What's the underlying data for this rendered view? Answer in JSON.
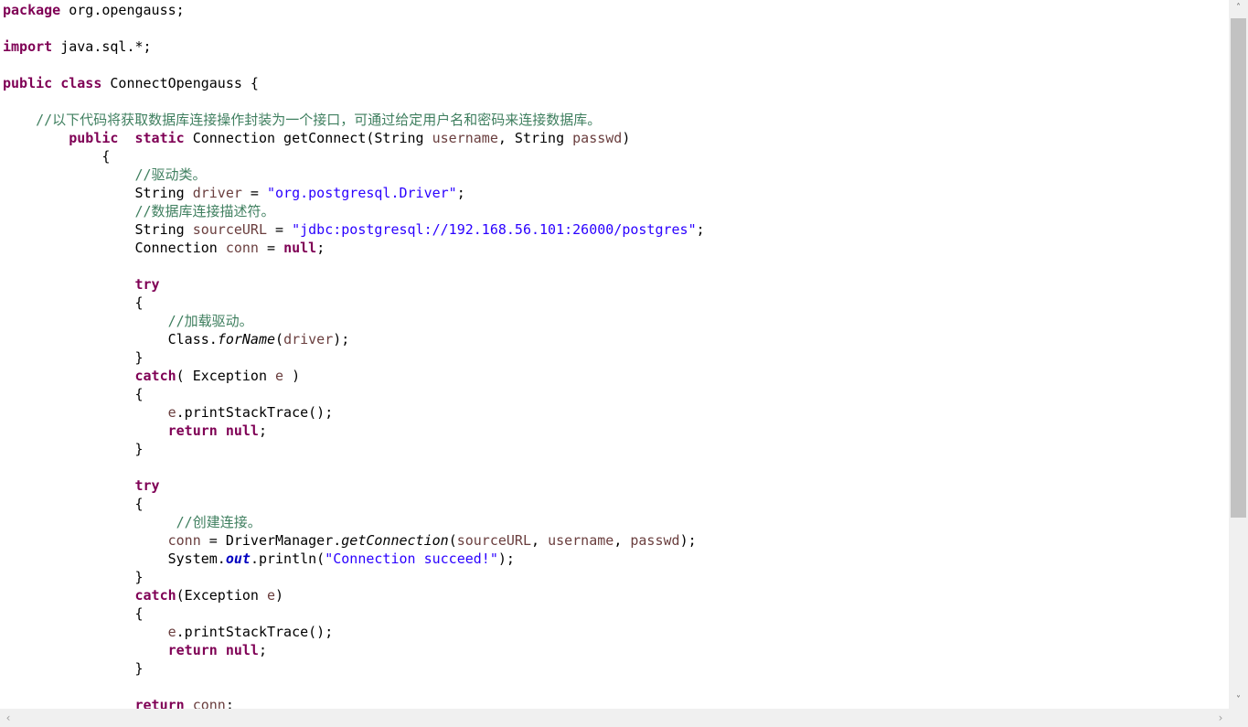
{
  "code_lines": [
    [
      {
        "t": "package",
        "c": "kw"
      },
      {
        "t": " org.opengauss;"
      }
    ],
    [],
    [
      {
        "t": "import",
        "c": "kw"
      },
      {
        "t": " java.sql.*;"
      }
    ],
    [],
    [
      {
        "t": "public",
        "c": "kw"
      },
      {
        "t": " "
      },
      {
        "t": "class",
        "c": "kw"
      },
      {
        "t": " ConnectOpengauss {"
      }
    ],
    [],
    [
      {
        "t": "    "
      },
      {
        "t": "//以下代码将获取数据库连接操作封装为一个接口，可通过给定用户名和密码来连接数据库。",
        "c": "cmt"
      }
    ],
    [
      {
        "t": "        "
      },
      {
        "t": "public",
        "c": "kw"
      },
      {
        "t": "  "
      },
      {
        "t": "static",
        "c": "kw"
      },
      {
        "t": " Connection getConnect(String "
      },
      {
        "t": "username",
        "c": "var"
      },
      {
        "t": ", String "
      },
      {
        "t": "passwd",
        "c": "var"
      },
      {
        "t": ")"
      }
    ],
    [
      {
        "t": "            {"
      }
    ],
    [
      {
        "t": "                "
      },
      {
        "t": "//驱动类。",
        "c": "cmt"
      }
    ],
    [
      {
        "t": "                String "
      },
      {
        "t": "driver",
        "c": "var"
      },
      {
        "t": " = "
      },
      {
        "t": "\"org.postgresql.Driver\"",
        "c": "str"
      },
      {
        "t": ";"
      }
    ],
    [
      {
        "t": "                "
      },
      {
        "t": "//数据库连接描述符。",
        "c": "cmt"
      }
    ],
    [
      {
        "t": "                String "
      },
      {
        "t": "sourceURL",
        "c": "var"
      },
      {
        "t": " = "
      },
      {
        "t": "\"jdbc:postgresql://192.168.56.101:26000/postgres\"",
        "c": "str"
      },
      {
        "t": ";"
      }
    ],
    [
      {
        "t": "                Connection "
      },
      {
        "t": "conn",
        "c": "var"
      },
      {
        "t": " = "
      },
      {
        "t": "null",
        "c": "kw"
      },
      {
        "t": ";"
      }
    ],
    [],
    [
      {
        "t": "                "
      },
      {
        "t": "try",
        "c": "kw"
      }
    ],
    [
      {
        "t": "                {"
      }
    ],
    [
      {
        "t": "                    "
      },
      {
        "t": "//加载驱动。",
        "c": "cmt"
      }
    ],
    [
      {
        "t": "                    Class."
      },
      {
        "t": "forName",
        "c": "it"
      },
      {
        "t": "("
      },
      {
        "t": "driver",
        "c": "var"
      },
      {
        "t": ");"
      }
    ],
    [
      {
        "t": "                }"
      }
    ],
    [
      {
        "t": "                "
      },
      {
        "t": "catch",
        "c": "kw"
      },
      {
        "t": "( Exception "
      },
      {
        "t": "e",
        "c": "var"
      },
      {
        "t": " )"
      }
    ],
    [
      {
        "t": "                {"
      }
    ],
    [
      {
        "t": "                    "
      },
      {
        "t": "e",
        "c": "var"
      },
      {
        "t": ".printStackTrace();"
      }
    ],
    [
      {
        "t": "                    "
      },
      {
        "t": "return",
        "c": "kw"
      },
      {
        "t": " "
      },
      {
        "t": "null",
        "c": "kw"
      },
      {
        "t": ";"
      }
    ],
    [
      {
        "t": "                }"
      }
    ],
    [],
    [
      {
        "t": "                "
      },
      {
        "t": "try",
        "c": "kw"
      }
    ],
    [
      {
        "t": "                {"
      }
    ],
    [
      {
        "t": "                     "
      },
      {
        "t": "//创建连接。",
        "c": "cmt"
      }
    ],
    [
      {
        "t": "                    "
      },
      {
        "t": "conn",
        "c": "var"
      },
      {
        "t": " = DriverManager."
      },
      {
        "t": "getConnection",
        "c": "it"
      },
      {
        "t": "("
      },
      {
        "t": "sourceURL",
        "c": "var"
      },
      {
        "t": ", "
      },
      {
        "t": "username",
        "c": "var"
      },
      {
        "t": ", "
      },
      {
        "t": "passwd",
        "c": "var"
      },
      {
        "t": ");"
      }
    ],
    [
      {
        "t": "                    System."
      },
      {
        "t": "out",
        "c": "static"
      },
      {
        "t": ".println("
      },
      {
        "t": "\"Connection succeed!\"",
        "c": "str"
      },
      {
        "t": ");"
      }
    ],
    [
      {
        "t": "                }"
      }
    ],
    [
      {
        "t": "                "
      },
      {
        "t": "catch",
        "c": "kw"
      },
      {
        "t": "(Exception "
      },
      {
        "t": "e",
        "c": "var"
      },
      {
        "t": ")"
      }
    ],
    [
      {
        "t": "                {"
      }
    ],
    [
      {
        "t": "                    "
      },
      {
        "t": "e",
        "c": "var"
      },
      {
        "t": ".printStackTrace();"
      }
    ],
    [
      {
        "t": "                    "
      },
      {
        "t": "return",
        "c": "kw"
      },
      {
        "t": " "
      },
      {
        "t": "null",
        "c": "kw"
      },
      {
        "t": ";"
      }
    ],
    [
      {
        "t": "                }"
      }
    ],
    [],
    [
      {
        "t": "                "
      },
      {
        "t": "return",
        "c": "kw"
      },
      {
        "t": " "
      },
      {
        "t": "conn",
        "c": "var"
      },
      {
        "t": ";"
      }
    ]
  ],
  "scrollbars": {
    "up_arrow": "˄",
    "down_arrow": "˅",
    "left_arrow": "‹",
    "right_arrow": "›"
  },
  "colors": {
    "keyword": "#7f0055",
    "string": "#2a00ff",
    "comment": "#3f7f5f",
    "variable": "#6a3e3e",
    "static_field": "#0000c0"
  }
}
